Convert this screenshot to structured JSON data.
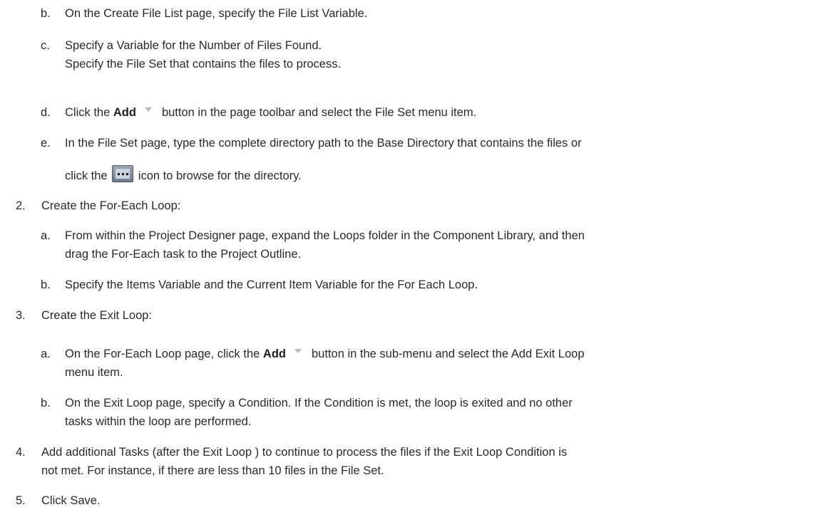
{
  "steps": {
    "s1b": {
      "marker": "b.",
      "text": "On the Create File List page, specify the File List Variable."
    },
    "s1c": {
      "marker": "c.",
      "line1": "Specify a Variable for the Number of Files Found.",
      "line2": "Specify the File Set that contains the files to process."
    },
    "s1d": {
      "marker": "d.",
      "pre": "Click the",
      "bold": "Add",
      "post": "button in the page toolbar and select the File Set menu item."
    },
    "s1e": {
      "marker": "e.",
      "line1": "In the File Set page, type the complete directory path to the Base Directory that contains the files or",
      "pre2": "click the",
      "post2": "icon to browse for the directory."
    },
    "s2": {
      "marker": "2.",
      "text": "Create the For-Each Loop:"
    },
    "s2a": {
      "marker": "a.",
      "line1": "From within the Project Designer page, expand the Loops folder in the Component Library, and then",
      "line2": "drag the For-Each task to the Project Outline."
    },
    "s2b": {
      "marker": "b.",
      "text": "Specify the Items Variable and the Current Item Variable for the For Each Loop."
    },
    "s3": {
      "marker": "3.",
      "text": "Create the Exit Loop:"
    },
    "s3a": {
      "marker": "a.",
      "pre": "On the For-Each Loop page, click the",
      "bold": "Add",
      "post": "button in the sub-menu and select the Add Exit Loop",
      "line2": "menu item."
    },
    "s3b": {
      "marker": "b.",
      "line1": "On the Exit Loop page, specify a Condition. If the Condition is met, the loop is exited and no other",
      "line2": "tasks within the loop are performed."
    },
    "s4": {
      "marker": "4.",
      "line1": "Add additional Tasks (after the Exit Loop ) to continue to process the files if the Exit Loop Condition is",
      "line2": "not met. For instance, if there are less than 10 files in the File Set."
    },
    "s5": {
      "marker": "5.",
      "text": "Click Save."
    }
  },
  "icons": {
    "dropdown": "chevron-down-icon",
    "browse": "ellipsis-browse-icon"
  }
}
